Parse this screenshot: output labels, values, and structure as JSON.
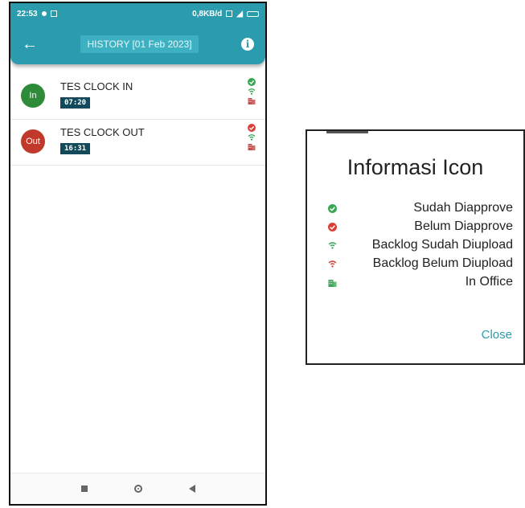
{
  "phone": {
    "status": {
      "time": "22:53",
      "network_speed": "0,8KB/d"
    },
    "header": {
      "title": "HISTORY [01 Feb 2023]"
    },
    "entries": [
      {
        "badge": "In",
        "badge_color": "#2e8b3a",
        "title": "TES CLOCK IN",
        "time": "07:20",
        "approve_status": "approved",
        "backlog_status": "uploaded",
        "office": "in-office"
      },
      {
        "badge": "Out",
        "badge_color": "#c0392b",
        "title": "TES CLOCK OUT",
        "time": "16:31",
        "approve_status": "not-approved",
        "backlog_status": "uploaded",
        "office": "in-office"
      }
    ]
  },
  "dialog": {
    "title": "Informasi Icon",
    "items": [
      {
        "icon": "check-circle-green-icon",
        "label": "Sudah Diapprove"
      },
      {
        "icon": "check-circle-red-icon",
        "label": "Belum Diapprove"
      },
      {
        "icon": "wifi-green-icon",
        "label": "Backlog Sudah Diupload"
      },
      {
        "icon": "wifi-red-icon",
        "label": "Backlog Belum Diupload"
      },
      {
        "icon": "building-green-icon",
        "label": "In Office"
      }
    ],
    "close_label": "Close"
  },
  "colors": {
    "primary": "#2a9cae",
    "approved": "#3aa655",
    "not_approved": "#d9403a",
    "time_badge": "#124a5c"
  }
}
